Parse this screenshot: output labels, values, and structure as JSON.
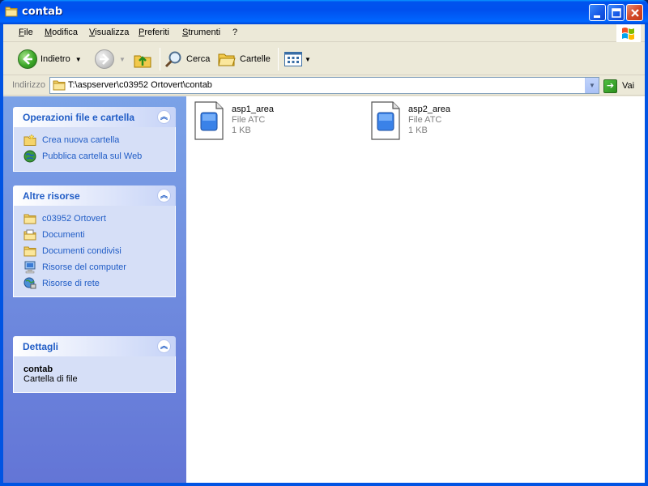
{
  "window": {
    "title": "contab"
  },
  "menu": [
    "File",
    "Modifica",
    "Visualizza",
    "Preferiti",
    "Strumenti",
    "?"
  ],
  "toolbar": {
    "back_label": "Indietro",
    "search_label": "Cerca",
    "folders_label": "Cartelle"
  },
  "address": {
    "label": "Indirizzo",
    "value": "T:\\aspserver\\c03952 Ortovert\\contab",
    "go_label": "Vai"
  },
  "sidebar": {
    "file_tasks": {
      "title": "Operazioni file e cartella",
      "items": [
        {
          "label": "Crea nuova cartella",
          "icon": "new-folder-icon"
        },
        {
          "label": "Pubblica cartella sul Web",
          "icon": "publish-web-icon"
        }
      ]
    },
    "other_places": {
      "title": "Altre risorse",
      "items": [
        {
          "label": "c03952 Ortovert",
          "icon": "folder-icon"
        },
        {
          "label": "Documenti",
          "icon": "documents-icon"
        },
        {
          "label": "Documenti condivisi",
          "icon": "folder-icon"
        },
        {
          "label": "Risorse del computer",
          "icon": "computer-icon"
        },
        {
          "label": "Risorse di rete",
          "icon": "network-icon"
        }
      ]
    },
    "details": {
      "title": "Dettagli",
      "name": "contab",
      "type": "Cartella di file"
    }
  },
  "files": [
    {
      "name": "asp1_area",
      "type": "File ATC",
      "size": "1 KB"
    },
    {
      "name": "asp2_area",
      "type": "File ATC",
      "size": "1 KB"
    }
  ],
  "colors": {
    "titlebar": "#0054e3",
    "sidebar_link": "#215dc6",
    "sidebar_bg": "#6375d6"
  }
}
